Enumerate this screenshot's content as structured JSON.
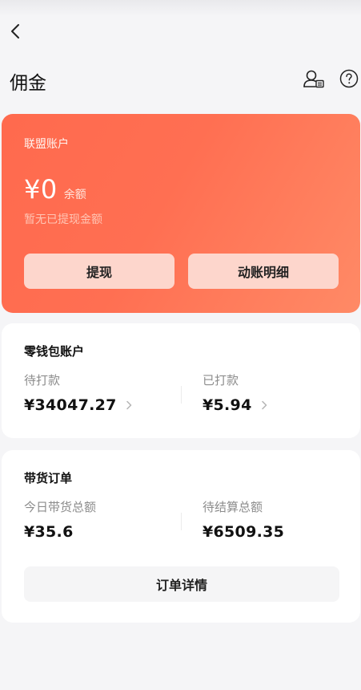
{
  "header": {
    "title": "佣金",
    "back_icon": "chevron-left-icon",
    "account_icon": "account-manage-icon",
    "help_icon": "question-circle-icon"
  },
  "alliance_account": {
    "label": "联盟账户",
    "amount": "¥0",
    "amount_suffix": "余额",
    "hint": "暂无已提现金额",
    "withdraw_label": "提现",
    "detail_label": "动账明细",
    "colors": {
      "card_start": "#ff6a4e",
      "card_end": "#ff8a66",
      "button_bg": "#fdd6cc"
    }
  },
  "wallet_account": {
    "title": "零钱包账户",
    "pending": {
      "label": "待打款",
      "value": "¥34047.27"
    },
    "paid": {
      "label": "已打款",
      "value": "¥5.94"
    }
  },
  "goods_orders": {
    "title": "带货订单",
    "today_total": {
      "label": "今日带货总额",
      "value": "¥35.6"
    },
    "pending_settlement": {
      "label": "待结算总额",
      "value": "¥6509.35"
    },
    "order_detail_label": "订单详情"
  }
}
